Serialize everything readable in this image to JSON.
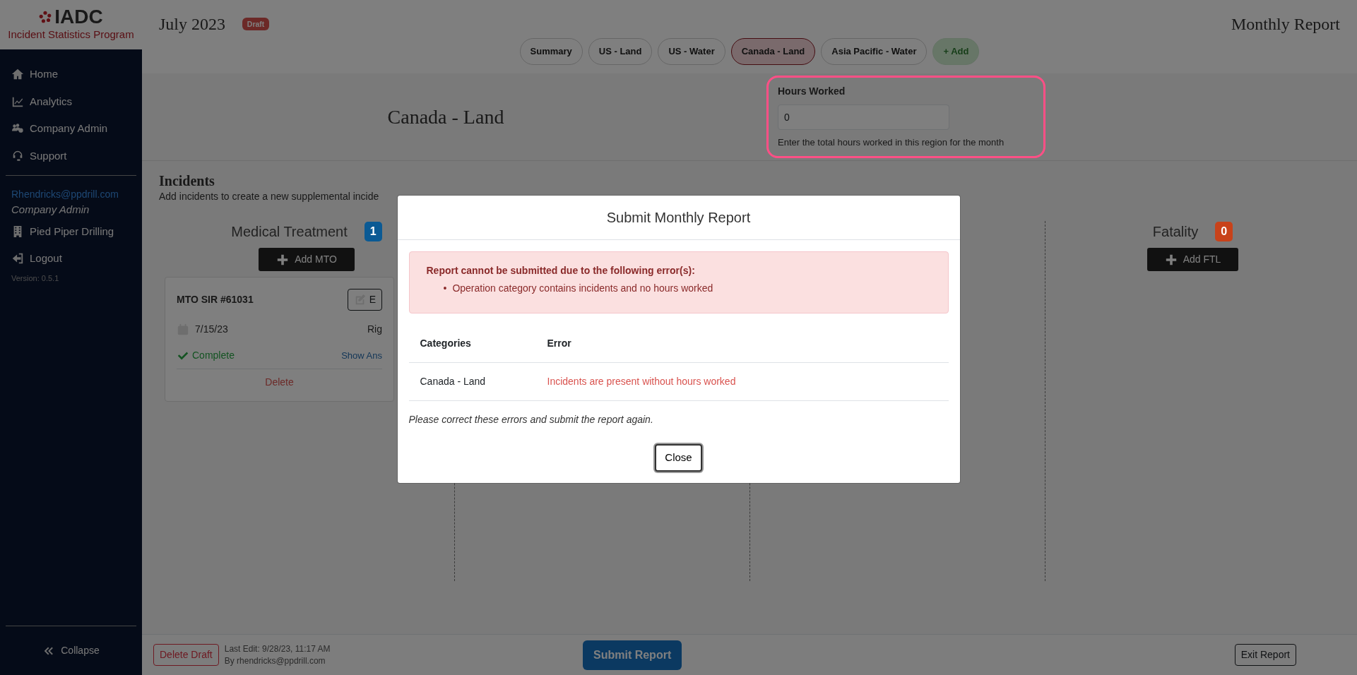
{
  "sidebar": {
    "logo_text": "IADC",
    "logo_subtitle": "Incident Statistics Program",
    "nav": [
      {
        "label": "Home"
      },
      {
        "label": "Analytics"
      },
      {
        "label": "Company Admin"
      },
      {
        "label": "Support"
      }
    ],
    "user": {
      "email": "Rhendricks@ppdrill.com",
      "role": "Company Admin",
      "company": "Pied Piper Drilling"
    },
    "logout": "Logout",
    "version": "Version: 0.5.1",
    "collapse": "Collapse"
  },
  "header": {
    "period": "July 2023",
    "status_badge": "Draft",
    "title": "Monthly Report"
  },
  "tabs": [
    {
      "label": "Summary",
      "selected": false
    },
    {
      "label": "US - Land",
      "selected": false
    },
    {
      "label": "US - Water",
      "selected": false
    },
    {
      "label": "Canada - Land",
      "selected": true
    },
    {
      "label": "Asia Pacific - Water",
      "selected": false
    }
  ],
  "add_tab": "+ Add",
  "region": {
    "title": "Canada - Land",
    "hours_worked": {
      "label": "Hours Worked",
      "value": "0",
      "help": "Enter the total hours worked in this region for the month"
    }
  },
  "incidents": {
    "title": "Incidents",
    "description": "Add incidents to create a new supplemental incide",
    "columns": [
      {
        "name": "Medical Treatment",
        "count": "1",
        "color": "#0b5a94",
        "button": "Add MTO",
        "cards": [
          {
            "title": "MTO SIR #61031",
            "edit": "E",
            "date": "7/15/23",
            "rig": "Rig",
            "status": "Complete",
            "complete": true,
            "link": "Show Ans",
            "delete": "Delete"
          }
        ]
      },
      {
        "name": "Fatality",
        "count": "0",
        "color": "#c8421a",
        "button": "Add FTL"
      }
    ]
  },
  "modal": {
    "title": "Submit Monthly Report",
    "alert": {
      "heading": "Report cannot be submitted due to the following error(s):",
      "bullet": "•",
      "items": [
        "Operation category contains incidents and no hours worked"
      ]
    },
    "table": {
      "columns": [
        "Categories",
        "Error"
      ],
      "rows": [
        {
          "category": "Canada - Land",
          "error": "Incidents are present without hours worked"
        }
      ]
    },
    "note": "Please correct these errors and submit the report again.",
    "close": "Close"
  },
  "footer": {
    "delete": "Delete Draft",
    "last_edit": "Last Edit: 9/28/23, 11:17 AM",
    "by": "By rhendricks@ppdrill.com",
    "submit": "Submit Report",
    "exit": "Exit Report"
  }
}
